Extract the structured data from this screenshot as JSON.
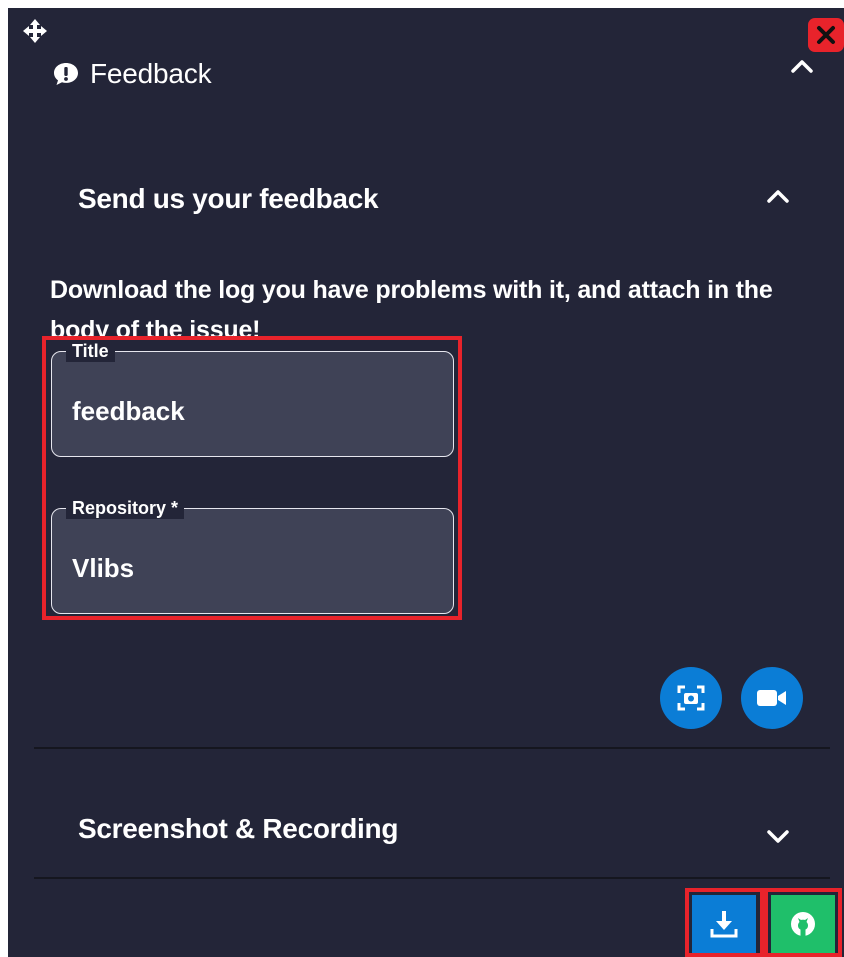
{
  "header": {
    "title": "Feedback",
    "icon": "feedback-icon",
    "close_icon": "close-icon",
    "move_icon": "move-icon"
  },
  "feedback_section": {
    "title": "Send us your feedback",
    "expanded": true,
    "description": "Download the log you have problems with it, and attach in the body of the issue!",
    "fields": {
      "title": {
        "label": "Title",
        "value": "feedback"
      },
      "repository": {
        "label": "Repository *",
        "value": "Vlibs"
      }
    },
    "actions": [
      "screenshot-icon",
      "video-camera-icon"
    ]
  },
  "screenshot_section": {
    "title": "Screenshot & Recording",
    "expanded": false
  },
  "footer": {
    "buttons": [
      "download-icon",
      "github-icon"
    ]
  },
  "colors": {
    "panel_bg": "#232538",
    "field_bg": "#3f4256",
    "accent_blue": "#0b7dd6",
    "github_green": "#1fbf6a",
    "highlight_red": "#e8232b"
  }
}
